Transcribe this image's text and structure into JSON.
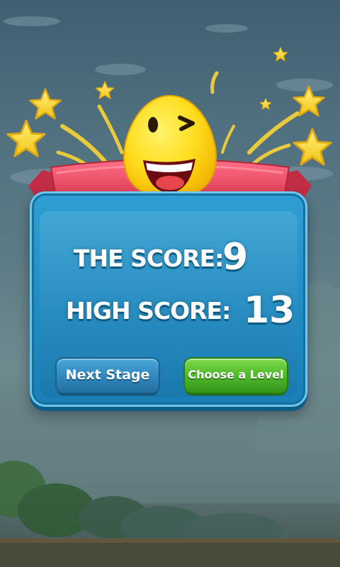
{
  "results": {
    "score_label": "THE SCORE:",
    "score_value": "9",
    "high_score_label": "HIGH SCORE:",
    "high_score_value": "13"
  },
  "buttons": {
    "next_stage": "Next Stage",
    "choose_level": "Choose a Level"
  },
  "colors": {
    "card_blue": "#1f8cc4",
    "ribbon_red": "#e8506b",
    "button_green": "#4fb82c",
    "button_blue": "#2f86bd",
    "star_yellow": "#f5d22a"
  },
  "icons": {
    "mascot": "winking-egg-icon",
    "decorations": "star-icon"
  }
}
